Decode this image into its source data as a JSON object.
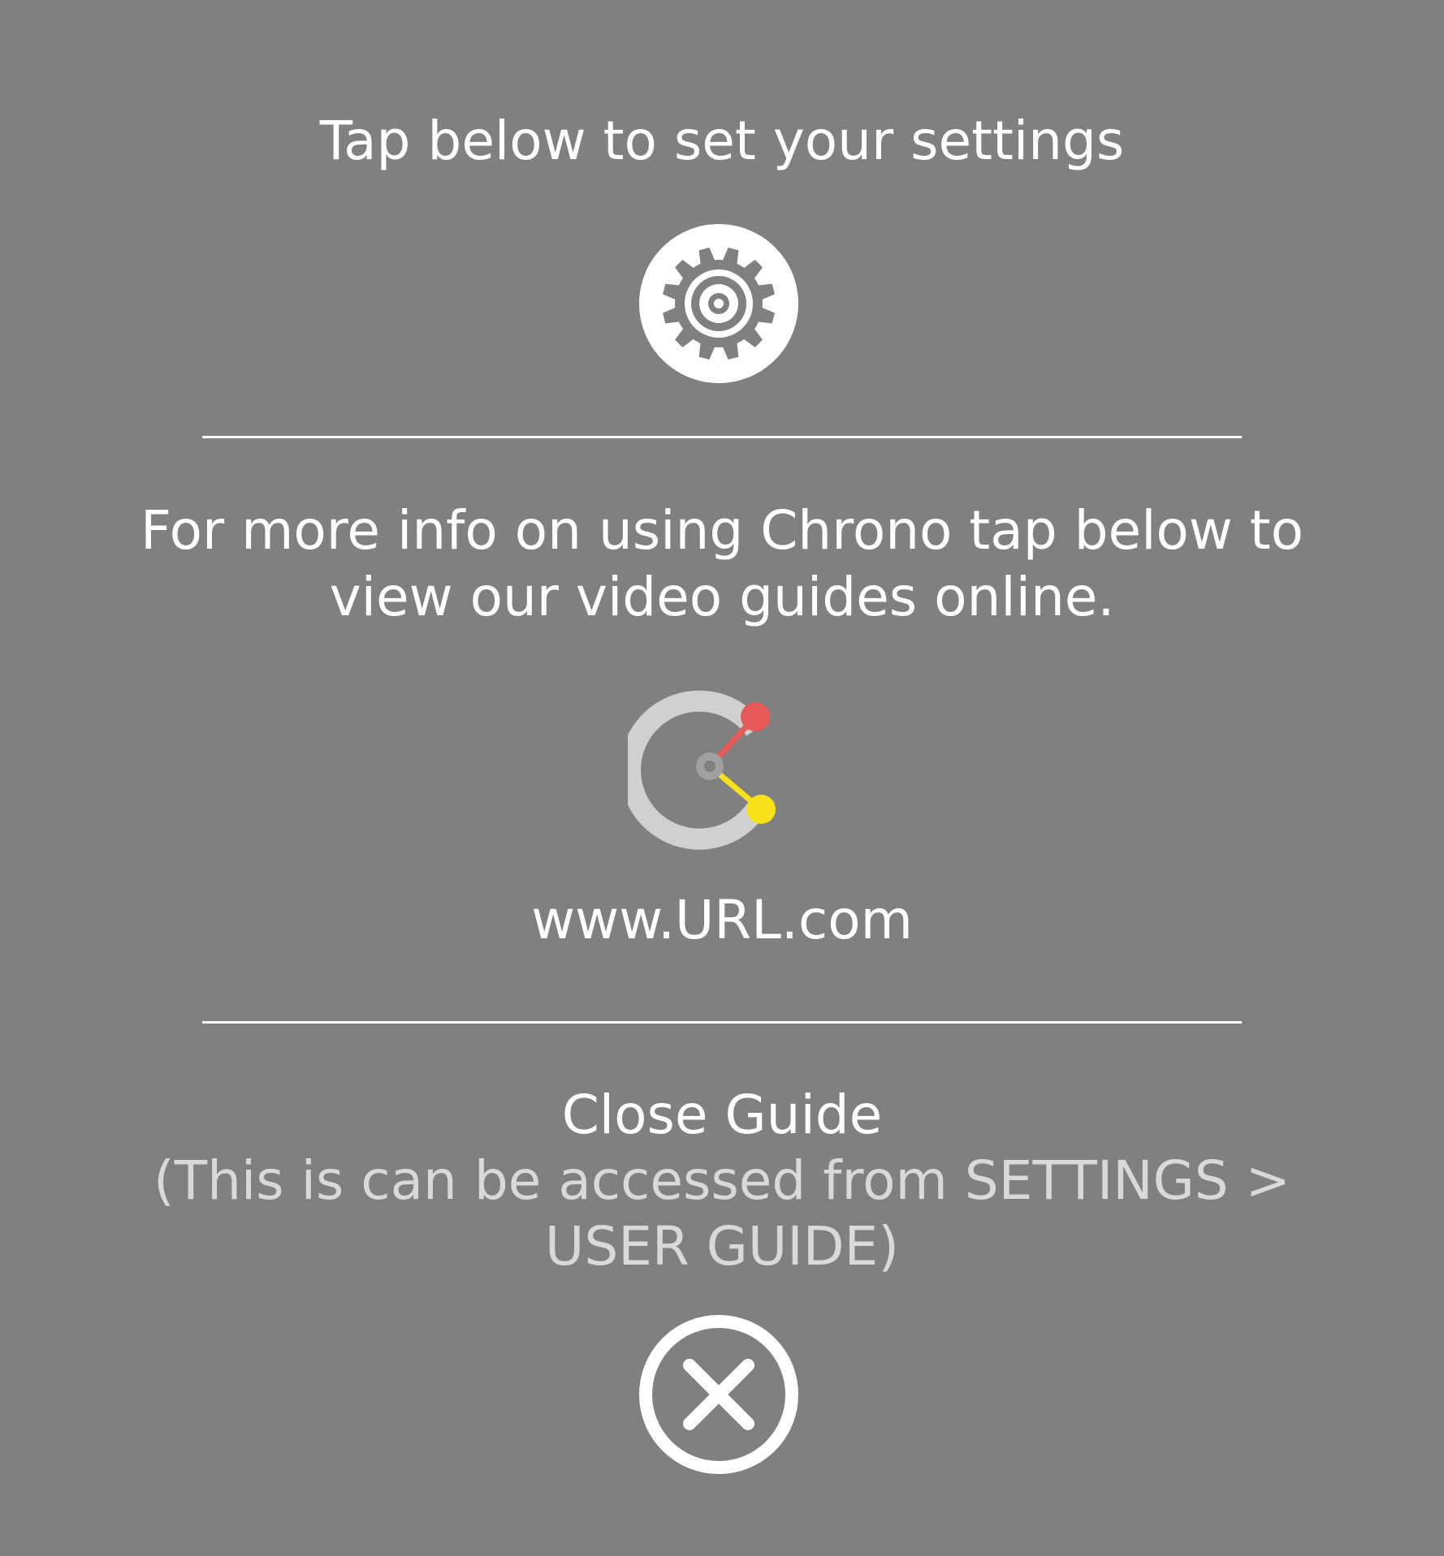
{
  "settings_section": {
    "heading": "Tap below to set your settings",
    "icon": "gear-icon"
  },
  "info_section": {
    "line1": "For more info on using Chrono tap below to",
    "line2": "view our video guides online.",
    "icon": "chrono-logo-icon",
    "url": "www.URL.com"
  },
  "close_section": {
    "heading": "Close Guide",
    "note_line1": "(This is can be accessed from SETTINGS >",
    "note_line2": "USER GUIDE)",
    "icon": "close-icon"
  },
  "colors": {
    "background": "#808080",
    "text": "#ffffff",
    "muted_text": "#d9d9d9",
    "logo_ring": "#d0d0d0",
    "logo_red": "#e85a5a",
    "logo_yellow": "#f6e11a"
  }
}
